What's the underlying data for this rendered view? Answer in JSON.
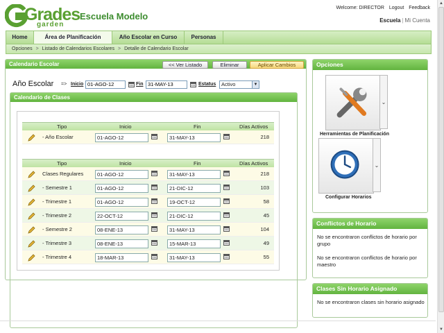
{
  "header": {
    "logo_text": "Grades",
    "logo_sub": "garden",
    "school_name": "Escuela Modelo",
    "welcome": "Welcome: DIRECTOR",
    "logout": "Logout",
    "feedback": "Feedback",
    "escuela": "Escuela",
    "sep": "|",
    "mi_cuenta": "Mi Cuenta"
  },
  "nav": {
    "tabs": [
      {
        "label": "Home"
      },
      {
        "label": "Área de Planificación"
      },
      {
        "label": "Año Escolar en Curso"
      },
      {
        "label": "Personas"
      }
    ],
    "active": "Área de Planificación"
  },
  "breadcrumb": [
    "Opciones",
    "Listado de Calendarios Escolares",
    "Detalle de Calendario Escolar"
  ],
  "breadcrumb_sep": ">",
  "calendar_panel": {
    "title": "Calendario Escolar",
    "btn_ver_listado": "<< Ver Listado",
    "btn_eliminar": "Eliminar",
    "btn_aplicar": "Aplicar Cambios",
    "year_title": "Año Escolar",
    "arrow": "=>",
    "inicio_label": "Inicio",
    "inicio_value": "01-AGO-12",
    "fin_label": "Fin",
    "fin_value": "31-MAY-13",
    "estatus_label": "Estatus",
    "estatus_value": "Activo",
    "estatus_arrow": "▼"
  },
  "classes_panel": {
    "title": "Calendario de Clases",
    "headers": {
      "tipo": "Tipo",
      "inicio": "Inicio",
      "fin": "Fin",
      "dias": "Días Activos"
    },
    "year_row": {
      "tipo": "- Año Escolar",
      "inicio": "01-AGO-12",
      "fin": "31-MAY-13",
      "dias": "218"
    },
    "rows": [
      {
        "tipo": "Clases Regulares",
        "inicio": "01-AGO-12",
        "fin": "31-MAY-13",
        "dias": "218"
      },
      {
        "tipo": "- Semestre 1",
        "inicio": "01-AGO-12",
        "fin": "21-DIC-12",
        "dias": "103"
      },
      {
        "tipo": "- Trimestre 1",
        "inicio": "01-AGO-12",
        "fin": "19-OCT-12",
        "dias": "58"
      },
      {
        "tipo": "- Trimestre 2",
        "inicio": "22-OCT-12",
        "fin": "21-DIC-12",
        "dias": "45"
      },
      {
        "tipo": "- Semestre 2",
        "inicio": "08-ENE-13",
        "fin": "31-MAY-13",
        "dias": "104"
      },
      {
        "tipo": "- Trimestre 3",
        "inicio": "08-ENE-13",
        "fin": "15-MAR-13",
        "dias": "49"
      },
      {
        "tipo": "- Trimestre 4",
        "inicio": "18-MAR-13",
        "fin": "31-MAY-13",
        "dias": "55"
      }
    ]
  },
  "options_panel": {
    "title": "Opciones",
    "tool1_label": "Herramientas de Planificación",
    "tool2_label": "Configurar Horarios",
    "dd_arrow": "⌄"
  },
  "conflicts_panel": {
    "title": "Conflictos de Horario",
    "msg1": "No se encontraron conflictos de horario por grupo",
    "msg2": "No se encontraron conflictos de horario por maestro"
  },
  "unassigned_panel": {
    "title": "Clases Sin Horario Asignado",
    "msg": "No se encontraron clases sin horario asignado"
  },
  "scrollbar": {
    "up": "▲",
    "down": "▼"
  },
  "colors": {
    "brand_green": "#5aa032",
    "panel_header": "#62b43f",
    "apply_button": "#f5d77c"
  }
}
